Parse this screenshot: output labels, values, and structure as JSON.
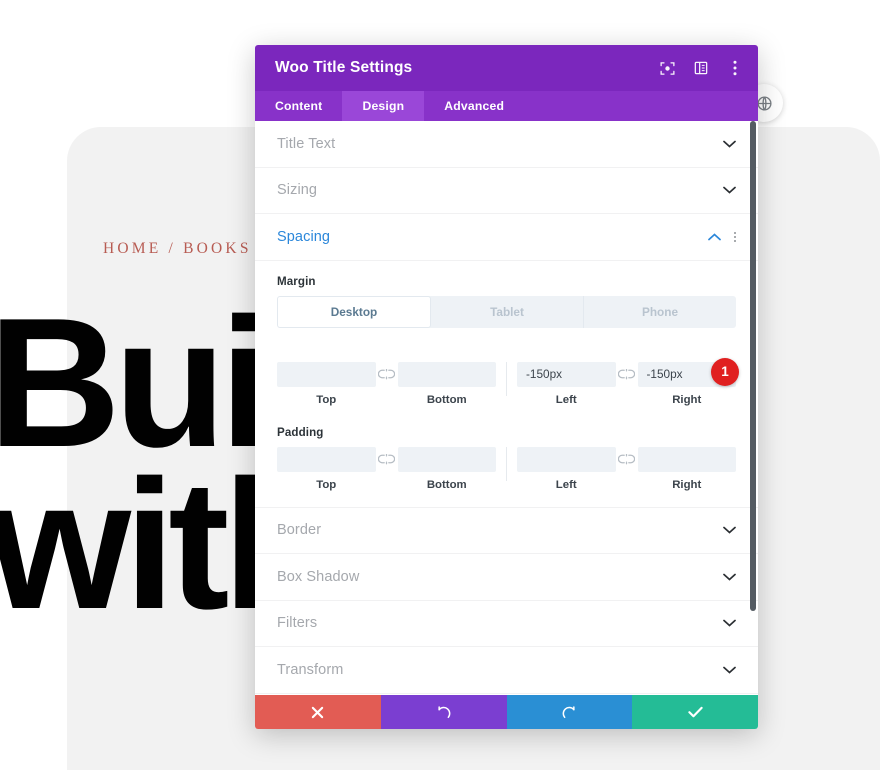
{
  "background": {
    "breadcrumb": "HOME / BOOKS /",
    "hero_line1": "Building.",
    "hero_line2": "with vi",
    "breadcrumb_color": "#b85c53",
    "card_color": "#f2f2f2",
    "globe_icon": "globe-icon"
  },
  "modal": {
    "title": "Woo Title Settings",
    "header_color": "#7b27bd",
    "header_icons": [
      {
        "name": "focus-target-icon",
        "label": "Focus"
      },
      {
        "name": "layout-panel-icon",
        "label": "Layout"
      },
      {
        "name": "more-vertical-icon",
        "label": "More options"
      }
    ],
    "tabs": [
      {
        "label": "Content",
        "active": false
      },
      {
        "label": "Design",
        "active": true
      },
      {
        "label": "Advanced",
        "active": false
      }
    ],
    "sections": [
      {
        "label": "Title Text",
        "open": false
      },
      {
        "label": "Sizing",
        "open": false
      },
      {
        "label": "Spacing",
        "open": true
      },
      {
        "label": "Border",
        "open": false
      },
      {
        "label": "Box Shadow",
        "open": false
      },
      {
        "label": "Filters",
        "open": false
      },
      {
        "label": "Transform",
        "open": false
      }
    ],
    "spacing": {
      "margin_title": "Margin",
      "padding_title": "Padding",
      "devices": [
        {
          "label": "Desktop",
          "active": true
        },
        {
          "label": "Tablet",
          "active": false
        },
        {
          "label": "Phone",
          "active": false
        }
      ],
      "margin": {
        "top": {
          "label": "Top",
          "value": "",
          "placeholder": ""
        },
        "bottom": {
          "label": "Bottom",
          "value": "",
          "placeholder": ""
        },
        "left": {
          "label": "Left",
          "value": "-150px",
          "placeholder": ""
        },
        "right": {
          "label": "Right",
          "value": "-150px",
          "placeholder": ""
        }
      },
      "padding": {
        "top": {
          "label": "Top",
          "value": "",
          "placeholder": ""
        },
        "bottom": {
          "label": "Bottom",
          "value": "",
          "placeholder": ""
        },
        "left": {
          "label": "Left",
          "value": "",
          "placeholder": ""
        },
        "right": {
          "label": "Right",
          "value": "",
          "placeholder": ""
        }
      },
      "link_icon": "broken-link-icon"
    },
    "badge": {
      "value": "1",
      "color": "#e02020"
    },
    "footer_buttons": [
      {
        "name": "close-button",
        "icon": "x-icon",
        "color": "#e25c54"
      },
      {
        "name": "undo-button",
        "icon": "undo-icon",
        "color": "#7b3ed1"
      },
      {
        "name": "redo-button",
        "icon": "redo-icon",
        "color": "#2a8fd4"
      },
      {
        "name": "save-button",
        "icon": "check-icon",
        "color": "#24bc96"
      }
    ]
  }
}
